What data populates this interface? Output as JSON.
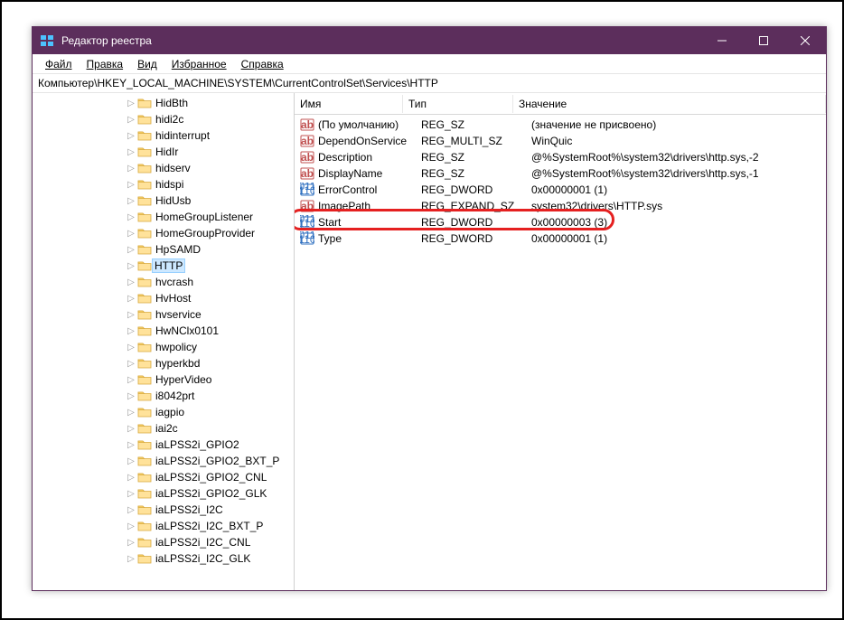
{
  "window": {
    "title": "Редактор реестра"
  },
  "menu": {
    "file": "Файл",
    "edit": "Правка",
    "view": "Вид",
    "favorites": "Избранное",
    "help": "Справка"
  },
  "address": "Компьютер\\HKEY_LOCAL_MACHINE\\SYSTEM\\CurrentControlSet\\Services\\HTTP",
  "tree": {
    "items": [
      {
        "label": "HidBth",
        "indent": 7
      },
      {
        "label": "hidi2c",
        "indent": 7
      },
      {
        "label": "hidinterrupt",
        "indent": 7
      },
      {
        "label": "HidIr",
        "indent": 7
      },
      {
        "label": "hidserv",
        "indent": 7
      },
      {
        "label": "hidspi",
        "indent": 7
      },
      {
        "label": "HidUsb",
        "indent": 7
      },
      {
        "label": "HomeGroupListener",
        "indent": 7
      },
      {
        "label": "HomeGroupProvider",
        "indent": 7
      },
      {
        "label": "HpSAMD",
        "indent": 7
      },
      {
        "label": "HTTP",
        "indent": 7,
        "selected": true
      },
      {
        "label": "hvcrash",
        "indent": 7
      },
      {
        "label": "HvHost",
        "indent": 7
      },
      {
        "label": "hvservice",
        "indent": 7
      },
      {
        "label": "HwNClx0101",
        "indent": 7
      },
      {
        "label": "hwpolicy",
        "indent": 7
      },
      {
        "label": "hyperkbd",
        "indent": 7
      },
      {
        "label": "HyperVideo",
        "indent": 7
      },
      {
        "label": "i8042prt",
        "indent": 7
      },
      {
        "label": "iagpio",
        "indent": 7
      },
      {
        "label": "iai2c",
        "indent": 7
      },
      {
        "label": "iaLPSS2i_GPIO2",
        "indent": 7
      },
      {
        "label": "iaLPSS2i_GPIO2_BXT_P",
        "indent": 7
      },
      {
        "label": "iaLPSS2i_GPIO2_CNL",
        "indent": 7
      },
      {
        "label": "iaLPSS2i_GPIO2_GLK",
        "indent": 7
      },
      {
        "label": "iaLPSS2i_I2C",
        "indent": 7
      },
      {
        "label": "iaLPSS2i_I2C_BXT_P",
        "indent": 7
      },
      {
        "label": "iaLPSS2i_I2C_CNL",
        "indent": 7
      },
      {
        "label": "iaLPSS2i_I2C_GLK",
        "indent": 7
      }
    ]
  },
  "list": {
    "headers": {
      "name": "Имя",
      "type": "Тип",
      "value": "Значение"
    },
    "rows": [
      {
        "icon": "str",
        "name": "(По умолчанию)",
        "type": "REG_SZ",
        "value": "(значение не присвоено)"
      },
      {
        "icon": "str",
        "name": "DependOnService",
        "type": "REG_MULTI_SZ",
        "value": "WinQuic"
      },
      {
        "icon": "str",
        "name": "Description",
        "type": "REG_SZ",
        "value": "@%SystemRoot%\\system32\\drivers\\http.sys,-2"
      },
      {
        "icon": "str",
        "name": "DisplayName",
        "type": "REG_SZ",
        "value": "@%SystemRoot%\\system32\\drivers\\http.sys,-1"
      },
      {
        "icon": "bin",
        "name": "ErrorControl",
        "type": "REG_DWORD",
        "value": "0x00000001 (1)"
      },
      {
        "icon": "str",
        "name": "ImagePath",
        "type": "REG_EXPAND_SZ",
        "value": "system32\\drivers\\HTTP.sys"
      },
      {
        "icon": "bin",
        "name": "Start",
        "type": "REG_DWORD",
        "value": "0x00000003 (3)",
        "highlighted": true
      },
      {
        "icon": "bin",
        "name": "Type",
        "type": "REG_DWORD",
        "value": "0x00000001 (1)"
      }
    ]
  }
}
